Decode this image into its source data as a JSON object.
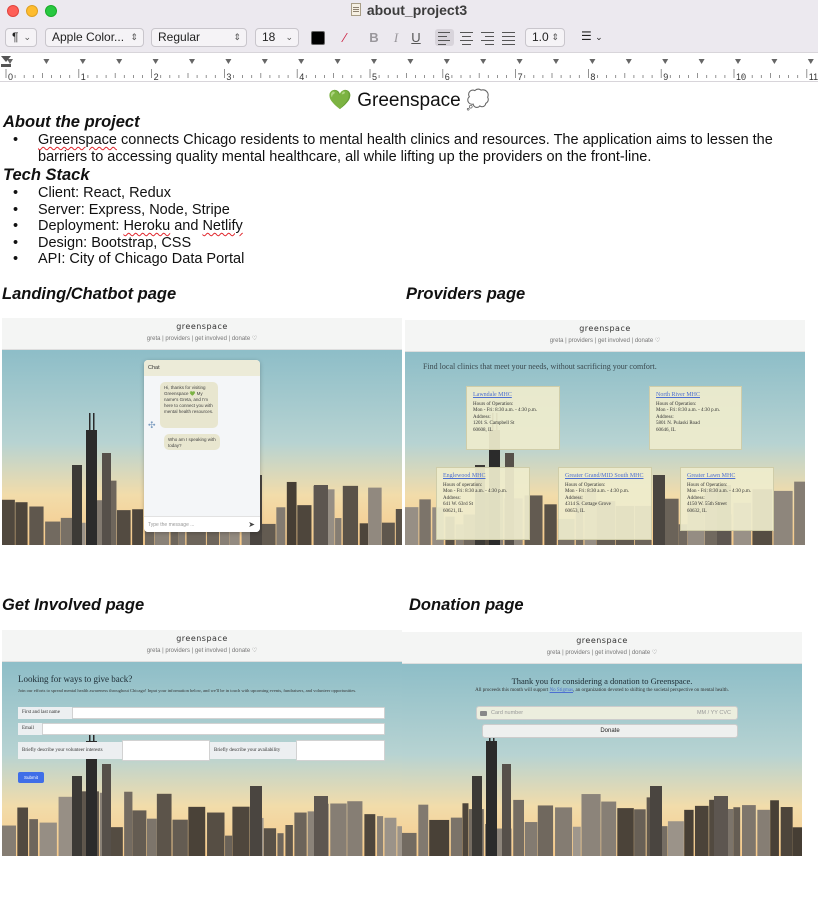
{
  "window": {
    "title": "about_project3"
  },
  "toolbar": {
    "paragraph_icon": "¶",
    "font_family": "Apple Color...",
    "font_style": "Regular",
    "font_size": "18",
    "text_color": "#000000",
    "bold": "B",
    "italic": "I",
    "underline": "U",
    "line_spacing": "1.0",
    "alignment_selected": "left"
  },
  "ruler": {
    "labels": [
      "0",
      "1",
      "2",
      "3",
      "4",
      "5",
      "6",
      "7",
      "8",
      "9",
      "10",
      "11"
    ]
  },
  "document": {
    "title": "Greenspace",
    "title_emoji_left": "💚",
    "title_emoji_right": "💭",
    "about_heading": "About the project",
    "about_text_first_word": "Greenspace",
    "about_text_rest": " connects Chicago residents to mental health clinics and resources. The application aims to lessen the barriers to accessing quality mental healthcare, all while lifting up the providers on the front-line.",
    "tech_heading": "Tech Stack",
    "tech_items": {
      "client": "Client: React, Redux",
      "server": "Server: Express, Node, Stripe",
      "deployment_prefix": "Deployment: ",
      "deployment_heroku": "Heroku",
      "deployment_and": " and ",
      "deployment_netlify": "Netlify",
      "design": "Design: Bootstrap, CSS",
      "api": "API: City of Chicago Data Portal"
    },
    "caption_landing": "Landing/Chatbot page",
    "caption_providers": "Providers page",
    "caption_involved": "Get Involved page",
    "caption_donation": "Donation page"
  },
  "site": {
    "brand": "greenspace",
    "nav": "greta  |  providers  |  get involved  |  donate ♡"
  },
  "chat": {
    "header": "Chat",
    "bubble_1": "Hi, thanks for visiting Greenspace 💚 My name's Greta, and I'm here to connect you with mental health resources.",
    "bubble_2": "Who am I speaking with today?",
    "input_placeholder": "Type the message ..."
  },
  "providers": {
    "lead": "Find local clinics that meet your needs, without sacrificing your comfort.",
    "cards": [
      {
        "name": "Lawndale MHC",
        "hours_label": "Hours of Operation:",
        "hours": "Mon - Fri: 8:30 a.m. - 4:30 p.m.",
        "address_label": "Address:",
        "street": "1201 S. Campbell St",
        "city": "60608, IL"
      },
      {
        "name": "North River MHC",
        "hours_label": "Hours of Operation:",
        "hours": "Mon - Fri: 8:30 a.m. - 4:30 p.m.",
        "address_label": "Address:",
        "street": "5801 N. Pulaski Road",
        "city": "60646, IL"
      },
      {
        "name": "Englewood MHC",
        "hours_label": "Hours of operation:",
        "hours": "Mon - Fri: 8:30 a.m. - 4:30 p.m.",
        "address_label": "Address:",
        "street": "641 W. 63rd St",
        "city": "60621, IL"
      },
      {
        "name": "Greater Grand/MID South MHC",
        "hours_label": "Hours of Operation:",
        "hours": "Mon - Fri: 8:30 a.m. - 4:30 p.m.",
        "address_label": "Address:",
        "street": "4314 S. Cottage Grove",
        "city": "60653, IL"
      },
      {
        "name": "Greater Lawn MHC",
        "hours_label": "Hours of Operation:",
        "hours": "Mon - Fri: 8:30 a.m. - 4:30 p.m.",
        "address_label": "Address:",
        "street": "4150 W. 55th Street",
        "city": "60632, IL"
      }
    ]
  },
  "involved": {
    "title": "Looking for ways to give back?",
    "description": "Join our efforts to spread mental health awareness throughout Chicago! Input your information below, and we'll be in touch with upcoming events, fundraisers, and volunteer opportunities.",
    "name_label": "First and last name",
    "email_label": "Email",
    "interests_label": "Briefly describe your volunteer interests",
    "availability_label": "Briefly describe your availability",
    "submit": "Submit"
  },
  "donation": {
    "title": "Thank you for considering a donation to Greenspace.",
    "desc_before": "All proceeds this month will support ",
    "desc_link": "No Stigmas",
    "desc_after": ", an organization devoted to shifting the societal perspective on mental health.",
    "card_placeholder": "Card number",
    "card_exp": "MM / YY  CVC",
    "donate_button": "Donate"
  },
  "colors": {
    "accent_blue": "#3f6ee8",
    "link_blue": "#4d6fd1",
    "card_bg": "#eeeccc",
    "spell_error": "#e0242b"
  }
}
